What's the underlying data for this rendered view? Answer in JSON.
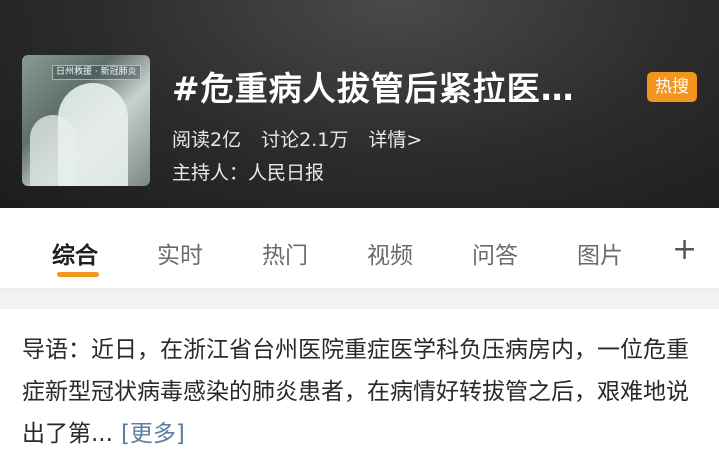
{
  "topic": {
    "title": "#危重病人拔管后紧拉医…",
    "badge": "热搜",
    "cover_tag": "日州救援 · 新冠肺炎",
    "stats": {
      "reads": "阅读2亿",
      "discussions": "讨论2.1万",
      "details": "详情>"
    },
    "host": "主持人：人民日报"
  },
  "tabs": [
    "综合",
    "实时",
    "热门",
    "视频",
    "问答",
    "图片"
  ],
  "intro": {
    "text": "导语：近日，在浙江省台州医院重症医学科负压病房内，一位危重症新型冠状病毒感染的肺炎患者，在病情好转拔管之后，艰难地说出了第...",
    "more": "[更多]"
  },
  "colors": {
    "accent": "#f4951f",
    "link": "#5b7fa3"
  },
  "icons": {
    "add": "plus-icon"
  }
}
